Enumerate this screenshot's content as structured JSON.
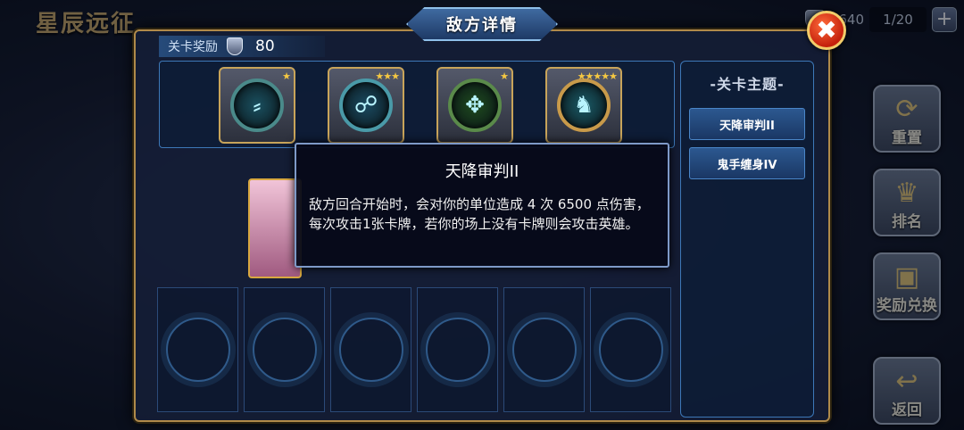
{
  "game": {
    "screen_title": "星辰远征",
    "currency_value": "5640",
    "stamina": "1/20",
    "add_label": "+"
  },
  "side_menu": [
    {
      "label": "重置",
      "icon": "refresh-icon"
    },
    {
      "label": "排名",
      "icon": "trophy-icon"
    },
    {
      "label": "奖励兑换",
      "icon": "gift-icon"
    }
  ],
  "back_label": "返回",
  "dialog": {
    "title": "敌方详情",
    "close_label": "✖",
    "reward_label": "关卡奖励",
    "reward_value": "80"
  },
  "badges": [
    {
      "icon": "rain-icon",
      "stars": 1,
      "ring": "#4a8a8a",
      "glow": "#1a5060"
    },
    {
      "icon": "ghost-icon",
      "stars": 3,
      "ring": "#4a9aa8",
      "glow": "#1a4a60"
    },
    {
      "icon": "claw-icon",
      "stars": 1,
      "ring": "#5a8a4a",
      "glow": "#1e4a1e"
    },
    {
      "icon": "dragon-icon",
      "stars": 5,
      "ring": "#c89a4a",
      "glow": "#1a5a66"
    }
  ],
  "topics": {
    "header": "-关卡主题-",
    "items": [
      "天降审判II",
      "鬼手缠身IV"
    ]
  },
  "tooltip": {
    "title": "天降审判II",
    "description": "敌方回合开始时，会对你的单位造成 4 次 6500 点伤害，每次攻击1张卡牌，若你的场上没有卡牌则会攻击英雄。"
  },
  "colors": {
    "accent_gold": "#c8a45a",
    "panel_blue": "#3d78b8",
    "close_red": "#c4200c"
  }
}
